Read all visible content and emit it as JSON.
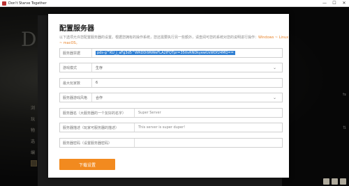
{
  "window": {
    "title": "Don't Starve Together",
    "minimize": "—",
    "maximize": "☐",
    "close": "✕"
  },
  "game": {
    "logo": "Do",
    "menu": [
      "浏",
      "玩",
      "物",
      "选",
      "编",
      "退"
    ]
  },
  "dialog": {
    "title": "配置服务器",
    "description_prefix": "以下选项允许您配置服务器的设置。根据您拥有的操作系统，您还需要执行另一些额外，请查阅可您的系统对您的说明进行操作：",
    "platforms": "Windows ~ Linux ~ macOS。",
    "fields": [
      {
        "label": "服务器票据",
        "value": "pds-g^KU_j_aFg3d5^WRDDi9NWeFLA2IFQTpr=35tlvRNDkyewUsWDf24MQ=="
      },
      {
        "label": "游戏模式",
        "value": "生存",
        "type": "select"
      },
      {
        "label": "最大玩家数",
        "value": "6"
      },
      {
        "label": "服务器游戏风格",
        "value": "合作",
        "type": "select"
      },
      {
        "label": "服务器名（大服务器的一个友好的名字）",
        "value": "Super Server"
      },
      {
        "label": "服务器描述（玩家可服务器的描述）",
        "value": "This server is super duper!"
      },
      {
        "label": "服务器密码（设置服务器密码）",
        "value": ""
      }
    ],
    "apply_label": "下载设置"
  }
}
